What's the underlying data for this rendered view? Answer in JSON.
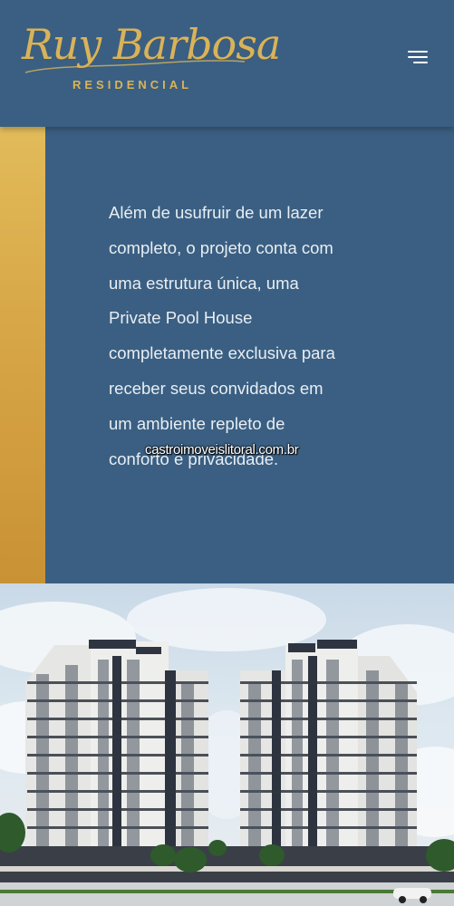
{
  "header": {
    "logo_script": "Ruy Barbosa",
    "logo_subtitle": "RESIDENCIAL",
    "menu_icon": "hamburger-menu-icon"
  },
  "colors": {
    "background": "#3a5f82",
    "gold": "#d9b35a",
    "text": "#e9eef3"
  },
  "content": {
    "paragraph": "Além de usufruir de um lazer completo, o projeto conta com uma estrutura única, uma Private Pool House completamente exclusiva para receber seus convidados em um ambiente repleto de conforto e privacidade.",
    "watermark": "castroimoveislitoral.com.br"
  },
  "photo": {
    "subject": "building-render-image"
  }
}
